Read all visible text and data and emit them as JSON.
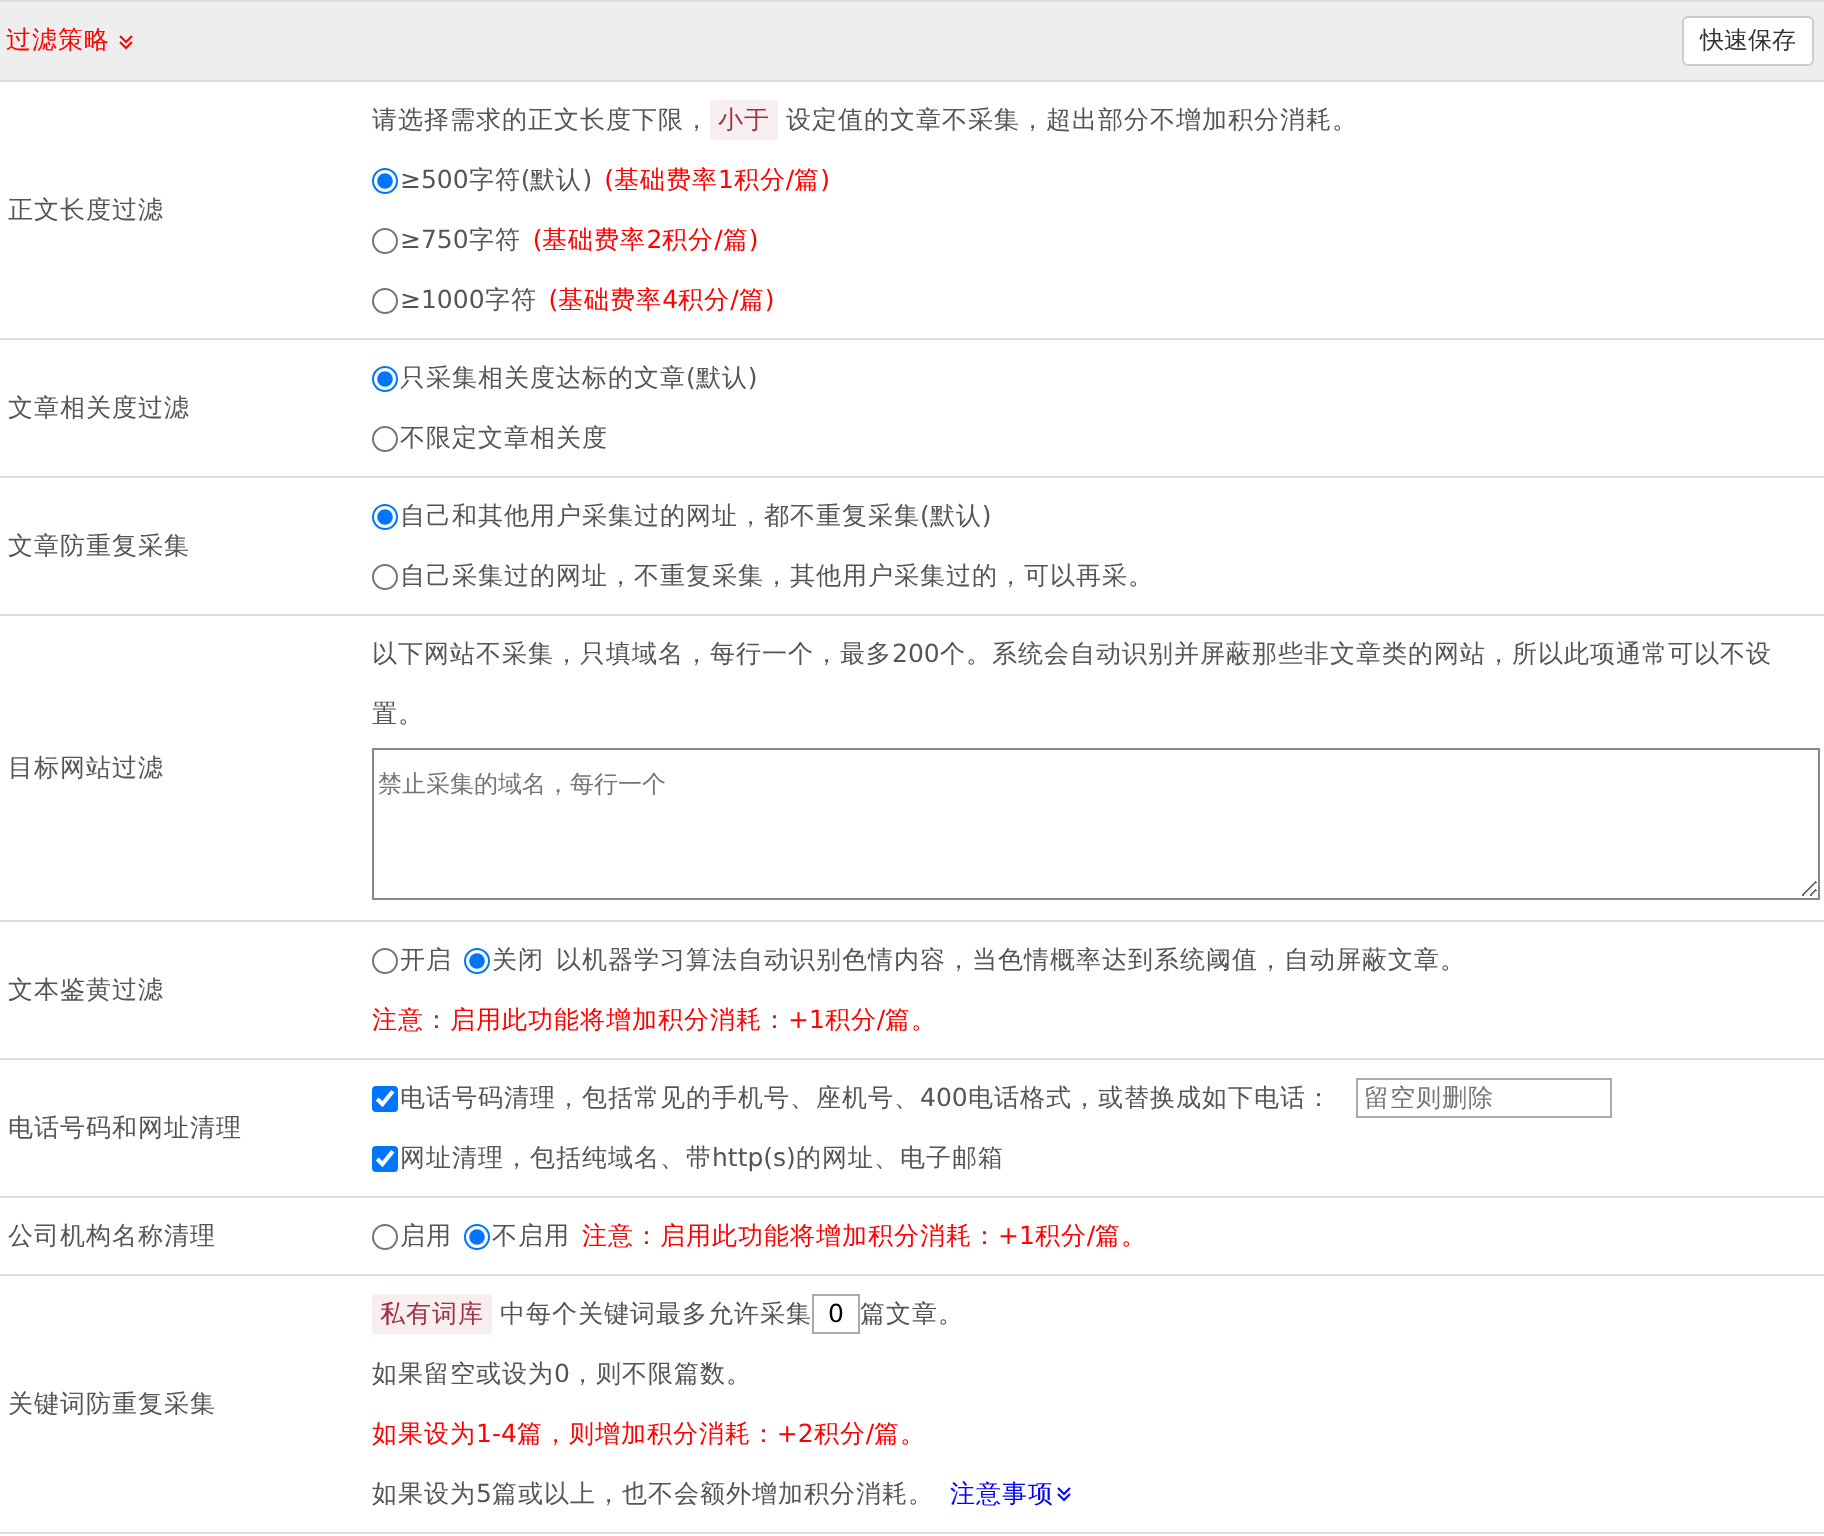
{
  "header": {
    "title": "过滤策略",
    "button": "快速保存"
  },
  "rows": [
    {
      "label": "正文长度过滤",
      "lines": [
        {
          "items": [
            {
              "kind": "text",
              "text": "请选择需求的正文长度下限，"
            },
            {
              "kind": "tag",
              "text": "小于"
            },
            {
              "kind": "text",
              "text": "设定值的文章不采集，超出部分不增加积分消耗。"
            }
          ]
        },
        {
          "items": [
            {
              "kind": "radio",
              "text": "≥500字符(默认)",
              "selected": true
            },
            {
              "kind": "warn",
              "text": "(基础费率1积分/篇)"
            }
          ]
        },
        {
          "items": [
            {
              "kind": "radio",
              "text": "≥750字符",
              "selected": false
            },
            {
              "kind": "warn",
              "text": "(基础费率2积分/篇)"
            }
          ]
        },
        {
          "items": [
            {
              "kind": "radio",
              "text": "≥1000字符",
              "selected": false
            },
            {
              "kind": "warn",
              "text": "(基础费率4积分/篇)"
            }
          ]
        }
      ]
    },
    {
      "label": "文章相关度过滤",
      "lines": [
        {
          "items": [
            {
              "kind": "radio",
              "text": "只采集相关度达标的文章(默认)",
              "selected": true
            }
          ]
        },
        {
          "items": [
            {
              "kind": "radio",
              "text": "不限定文章相关度",
              "selected": false
            }
          ]
        }
      ]
    },
    {
      "label": "文章防重复采集",
      "lines": [
        {
          "items": [
            {
              "kind": "radio",
              "text": "自己和其他用户采集过的网址，都不重复采集(默认)",
              "selected": true
            }
          ]
        },
        {
          "items": [
            {
              "kind": "radio",
              "text": "自己采集过的网址，不重复采集，其他用户采集过的，可以再采。",
              "selected": false
            }
          ]
        }
      ]
    },
    {
      "label": "目标网站过滤",
      "lines": [
        {
          "items": [
            {
              "kind": "text",
              "text": "以下网站不采集，只填域名，每行一个，最多200个。系统会自动识别并屏蔽那些非文章类的网站，所以此项通常可以不设置。"
            }
          ]
        },
        {
          "items": [
            {
              "kind": "textarea",
              "placeholder": "禁止采集的域名，每行一个"
            }
          ]
        }
      ]
    },
    {
      "label": "文本鉴黄过滤",
      "lines": [
        {
          "items": [
            {
              "kind": "radio",
              "text": "开启",
              "selected": false
            },
            {
              "kind": "radio",
              "text": "关闭",
              "selected": true
            },
            {
              "kind": "text",
              "text": "以机器学习算法自动识别色情内容，当色情概率达到系统阈值，自动屏蔽文章。"
            }
          ]
        },
        {
          "items": [
            {
              "kind": "warn",
              "text": "注意：启用此功能将增加积分消耗：+1积分/篇。"
            }
          ]
        }
      ]
    },
    {
      "label": "电话号码和网址清理",
      "lines": [
        {
          "items": [
            {
              "kind": "checkbox",
              "text": "电话号码清理，包括常见的手机号、座机号、400电话格式，或替换成如下电话：",
              "checked": true
            },
            {
              "kind": "input",
              "placeholder": "留空则删除"
            }
          ]
        },
        {
          "items": [
            {
              "kind": "checkbox",
              "text": "网址清理，包括纯域名、带http(s)的网址、电子邮箱",
              "checked": true
            }
          ]
        }
      ]
    },
    {
      "label": "公司机构名称清理",
      "lines": [
        {
          "items": [
            {
              "kind": "radio",
              "text": "启用",
              "selected": false
            },
            {
              "kind": "radio",
              "text": "不启用",
              "selected": true
            },
            {
              "kind": "warn",
              "text": "注意：启用此功能将增加积分消耗：+1积分/篇。"
            }
          ]
        }
      ]
    },
    {
      "label": "关键词防重复采集",
      "lines": [
        {
          "items": [
            {
              "kind": "tag",
              "text": "私有词库"
            },
            {
              "kind": "text",
              "text": "中每个关键词最多允许采集"
            },
            {
              "kind": "number",
              "value": "0"
            },
            {
              "kind": "text",
              "text": "篇文章。"
            }
          ]
        },
        {
          "items": [
            {
              "kind": "text",
              "text": "如果留空或设为0，则不限篇数。"
            }
          ]
        },
        {
          "items": [
            {
              "kind": "warn",
              "text": "如果设为1-4篇，则增加积分消耗：+2积分/篇。"
            }
          ]
        },
        {
          "items": [
            {
              "kind": "text",
              "text": "如果设为5篇或以上，也不会额外增加积分消耗。"
            },
            {
              "kind": "link",
              "text": "注意事项"
            }
          ]
        }
      ]
    }
  ]
}
